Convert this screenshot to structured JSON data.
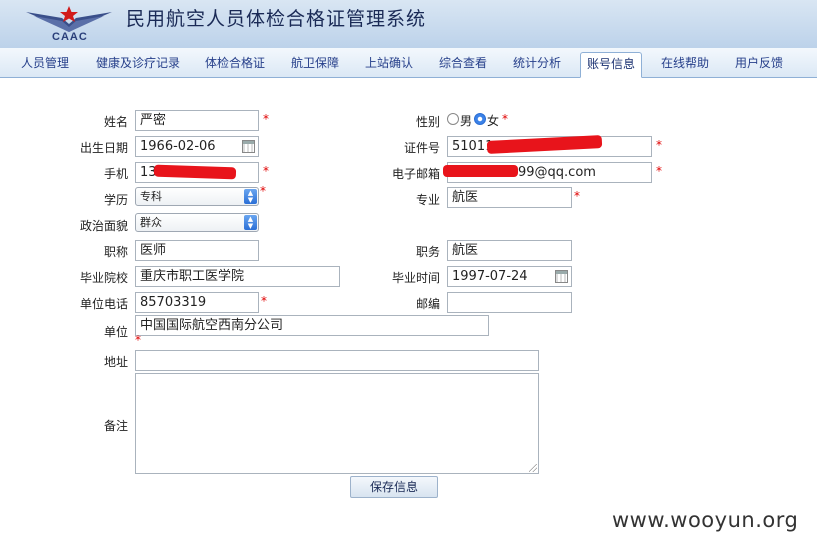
{
  "app": {
    "title": "民用航空人员体检合格证管理系统",
    "logo_text": "CAAC"
  },
  "nav": {
    "items": [
      {
        "label": "人员管理"
      },
      {
        "label": "健康及诊疗记录"
      },
      {
        "label": "体检合格证"
      },
      {
        "label": "航卫保障"
      },
      {
        "label": "上站确认"
      },
      {
        "label": "综合查看"
      },
      {
        "label": "统计分析"
      },
      {
        "label": "账号信息",
        "active": true
      },
      {
        "label": "在线帮助"
      },
      {
        "label": "用户反馈"
      }
    ]
  },
  "form": {
    "name": {
      "label": "姓名",
      "value": "严密"
    },
    "gender": {
      "label": "性别",
      "options": [
        "男",
        "女"
      ],
      "selected": "女"
    },
    "birth": {
      "label": "出生日期",
      "value": "1966-02-06"
    },
    "id_no": {
      "label": "证件号",
      "value": "51011"
    },
    "phone": {
      "label": "手机",
      "value": "13"
    },
    "email": {
      "label": "电子邮箱",
      "value": "99@qq.com"
    },
    "education": {
      "label": "学历",
      "value": "专科"
    },
    "major": {
      "label": "专业",
      "value": "航医"
    },
    "politics": {
      "label": "政治面貌",
      "value": "群众"
    },
    "title": {
      "label": "职称",
      "value": "医师"
    },
    "duty": {
      "label": "职务",
      "value": "航医"
    },
    "school": {
      "label": "毕业院校",
      "value": "重庆市职工医学院"
    },
    "grad_date": {
      "label": "毕业时间",
      "value": "1997-07-24"
    },
    "work_phone": {
      "label": "单位电话",
      "value": "85703319"
    },
    "postcode": {
      "label": "邮编",
      "value": ""
    },
    "company": {
      "label": "单位",
      "value": "中国国际航空西南分公司"
    },
    "address": {
      "label": "地址",
      "value": ""
    },
    "remark": {
      "label": "备注",
      "value": ""
    },
    "required_mark": "*",
    "save_label": "保存信息"
  },
  "watermark": "www.wooyun.org",
  "colors": {
    "required": "#e00000",
    "redaction": "#e8141b",
    "nav_text": "#27408b"
  }
}
